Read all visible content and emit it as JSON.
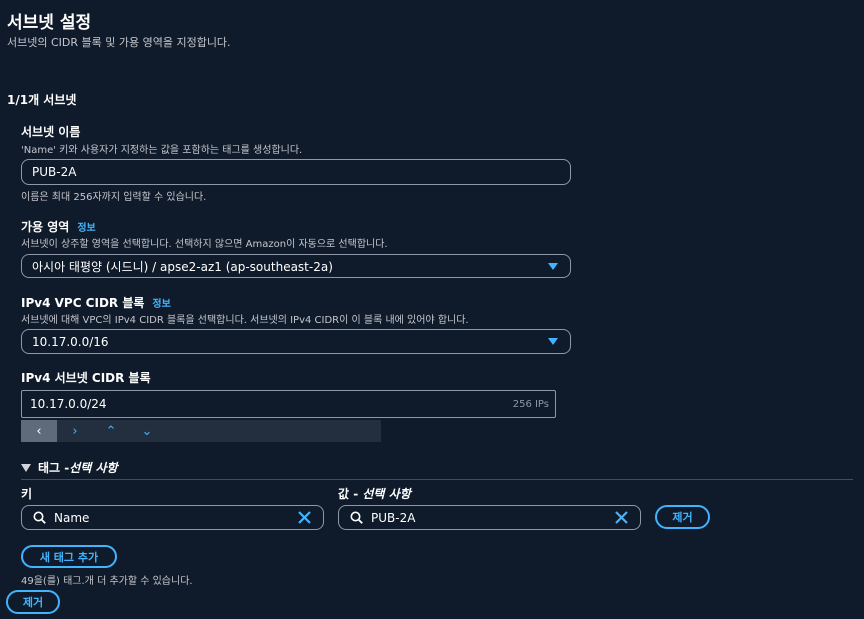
{
  "header": {
    "title": "서브넷 설정",
    "subtitle": "서브넷의 CIDR 블록 및 가용 영역을 지정합니다."
  },
  "counter": "1/1개 서브넷",
  "subnet_name": {
    "label": "서브넷 이름",
    "description": "'Name' 키와 사용자가 지정하는 값을 포함하는 태그를 생성합니다.",
    "value": "PUB-2A",
    "hint": "이름은 최대 256자까지 입력할 수 있습니다."
  },
  "availability_zone": {
    "label": "가용 영역",
    "info": "정보",
    "description": "서브넷이 상주할 영역을 선택합니다. 선택하지 않으면 Amazon이 자동으로 선택합니다.",
    "value": "아시아 태평양 (시드니) / apse2-az1 (ap-southeast-2a)"
  },
  "vpc_cidr": {
    "label": "IPv4 VPC CIDR 블록",
    "info": "정보",
    "description": "서브넷에 대해 VPC의 IPv4 CIDR 블록을 선택합니다. 서브넷의 IPv4 CIDR이 이 블록 내에 있어야 합니다.",
    "value": "10.17.0.0/16"
  },
  "subnet_cidr": {
    "label": "IPv4 서브넷 CIDR 블록",
    "value": "10.17.0.0/24",
    "ip_count": "256 IPs",
    "stepper": [
      "‹",
      "›",
      "⌃",
      "⌄"
    ]
  },
  "tags": {
    "section_title": "태그 - ",
    "section_optional": "선택 사항",
    "key_label": "키",
    "value_label": "값 - ",
    "value_optional": "선택 사항",
    "rows": [
      {
        "key": "Name",
        "value": "PUB-2A",
        "remove_label": "제거"
      }
    ],
    "add_label": "새 태그 추가",
    "limit_note": "49을(를) 태그.개 더 추가할 수 있습니다."
  },
  "remove_subnet_label": "제거",
  "icons": {
    "expand": "triangle-down-icon",
    "search": "search-icon",
    "clear": "close-icon",
    "dropdown": "caret-down-icon"
  },
  "colors": {
    "background": "#0f1b2a",
    "accent": "#42b4ff",
    "border": "#8d99a8"
  }
}
